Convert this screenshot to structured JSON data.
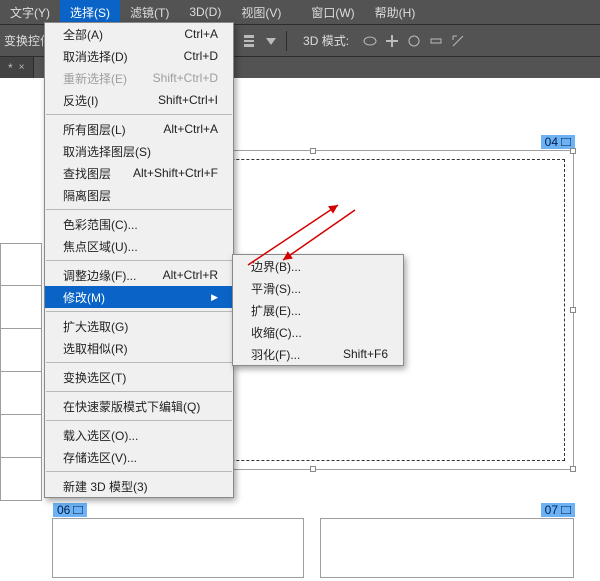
{
  "menubar": {
    "items": [
      {
        "label": "文字(Y)"
      },
      {
        "label": "选择(S)"
      },
      {
        "label": "滤镜(T)"
      },
      {
        "label": "3D(D)"
      },
      {
        "label": "视图(V)"
      },
      {
        "label": "窗口(W)"
      },
      {
        "label": "帮助(H)"
      }
    ],
    "active_index": 1
  },
  "optionbar": {
    "left_label": "变换控件",
    "mode3d_label": "3D 模式:"
  },
  "tab": {
    "title": "*",
    "close": "×"
  },
  "artboards": {
    "b04": "04",
    "b06": "06",
    "b07": "07"
  },
  "dropdown": {
    "items": [
      {
        "label": "全部(A)",
        "shortcut": "Ctrl+A"
      },
      {
        "label": "取消选择(D)",
        "shortcut": "Ctrl+D"
      },
      {
        "label": "重新选择(E)",
        "shortcut": "Shift+Ctrl+D",
        "disabled": true
      },
      {
        "label": "反选(I)",
        "shortcut": "Shift+Ctrl+I"
      },
      {
        "sep": true
      },
      {
        "label": "所有图层(L)",
        "shortcut": "Alt+Ctrl+A"
      },
      {
        "label": "取消选择图层(S)",
        "shortcut": ""
      },
      {
        "label": "查找图层",
        "shortcut": "Alt+Shift+Ctrl+F"
      },
      {
        "label": "隔离图层",
        "shortcut": ""
      },
      {
        "sep": true
      },
      {
        "label": "色彩范围(C)...",
        "shortcut": ""
      },
      {
        "label": "焦点区域(U)...",
        "shortcut": ""
      },
      {
        "sep": true
      },
      {
        "label": "调整边缘(F)...",
        "shortcut": "Alt+Ctrl+R"
      },
      {
        "label": "修改(M)",
        "shortcut": "",
        "submenu": true,
        "highlight": true
      },
      {
        "sep": true
      },
      {
        "label": "扩大选取(G)",
        "shortcut": ""
      },
      {
        "label": "选取相似(R)",
        "shortcut": ""
      },
      {
        "sep": true
      },
      {
        "label": "变换选区(T)",
        "shortcut": ""
      },
      {
        "sep": true
      },
      {
        "label": "在快速蒙版模式下编辑(Q)",
        "shortcut": ""
      },
      {
        "sep": true
      },
      {
        "label": "载入选区(O)...",
        "shortcut": ""
      },
      {
        "label": "存储选区(V)...",
        "shortcut": ""
      },
      {
        "sep": true
      },
      {
        "label": "新建 3D 模型(3)",
        "shortcut": ""
      }
    ]
  },
  "submenu": {
    "items": [
      {
        "label": "边界(B)...",
        "shortcut": ""
      },
      {
        "label": "平滑(S)...",
        "shortcut": ""
      },
      {
        "label": "扩展(E)...",
        "shortcut": ""
      },
      {
        "label": "收缩(C)...",
        "shortcut": ""
      },
      {
        "label": "羽化(F)...",
        "shortcut": "Shift+F6"
      }
    ]
  }
}
